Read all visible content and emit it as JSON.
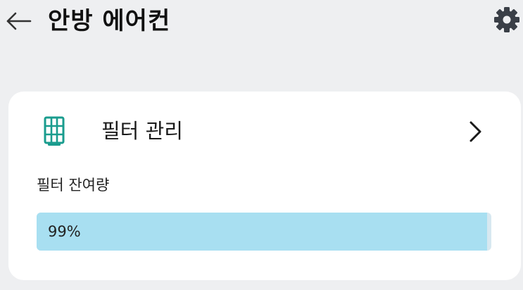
{
  "header": {
    "title": "안방 에어컨",
    "back_icon": "arrow-left-icon",
    "settings_icon": "gear-icon"
  },
  "filter_card": {
    "icon": "air-filter-icon",
    "title": "필터 관리",
    "chevron_icon": "chevron-right-icon",
    "remaining_label": "필터 잔여량",
    "remaining_value": "99%",
    "remaining_fraction": 0.99
  },
  "colors": {
    "background": "#eeeff1",
    "card": "#ffffff",
    "accent_teal": "#1a9c8e",
    "bar_fill": "#a8dff1",
    "bar_track": "#d7e8f0",
    "gear": "#3a3f47"
  }
}
